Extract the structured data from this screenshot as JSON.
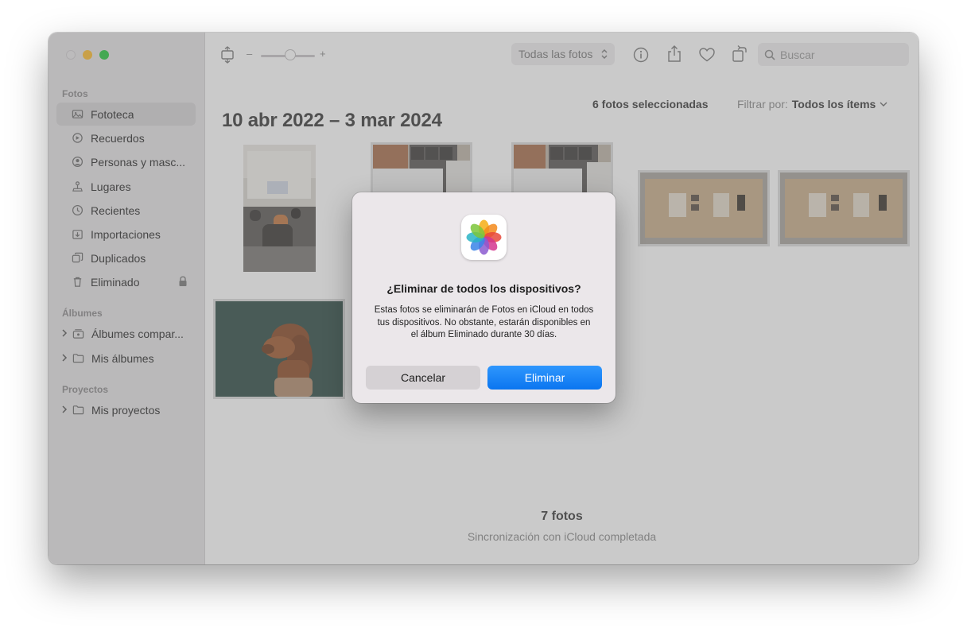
{
  "window": {
    "controls": [
      "close",
      "minimize",
      "zoom"
    ]
  },
  "sidebar": {
    "section_photos": "Fotos",
    "items": [
      {
        "label": "Fototeca",
        "icon": "photo-library-icon",
        "active": true
      },
      {
        "label": "Recuerdos",
        "icon": "memories-icon"
      },
      {
        "label": "Personas y masc...",
        "icon": "people-icon"
      },
      {
        "label": "Lugares",
        "icon": "places-icon"
      },
      {
        "label": "Recientes",
        "icon": "recents-icon"
      },
      {
        "label": "Importaciones",
        "icon": "imports-icon"
      },
      {
        "label": "Duplicados",
        "icon": "duplicates-icon"
      },
      {
        "label": "Eliminado",
        "icon": "trash-icon",
        "locked": true
      }
    ],
    "section_albums": "Álbumes",
    "albums": [
      {
        "label": "Álbumes compar...",
        "icon": "shared-albums-icon"
      },
      {
        "label": "Mis álbumes",
        "icon": "folder-icon"
      }
    ],
    "section_projects": "Proyectos",
    "projects": [
      {
        "label": "Mis proyectos",
        "icon": "folder-icon"
      }
    ]
  },
  "toolbar": {
    "zoom_minus": "–",
    "zoom_plus": "+",
    "zoom_level": 0.55,
    "view_popup": "Todas las fotos",
    "search_placeholder": "Buscar",
    "icons": [
      "info-icon",
      "share-icon",
      "favorite-heart-icon",
      "rotate-icon",
      "search-icon"
    ]
  },
  "library": {
    "date_range": "10 abr 2022 – 3 mar 2024",
    "selected_count": "6 fotos seleccionadas",
    "filter_label": "Filtrar por:",
    "filter_value": "Todos los ítems",
    "photos": [
      {
        "subject": "conference room presentation",
        "selected": false
      },
      {
        "subject": "office shelves and monitor",
        "selected": true
      },
      {
        "subject": "office shelves and monitor",
        "selected": true
      },
      {
        "subject": "cardboard box",
        "selected": true
      },
      {
        "subject": "cardboard box",
        "selected": true
      },
      {
        "subject": "dog with hat",
        "selected": true
      }
    ],
    "photo_total": "7 fotos",
    "sync_status": "Sincronización con iCloud completada"
  },
  "dialog": {
    "title": "¿Eliminar de todos los dispositivos?",
    "message": "Estas fotos se eliminarán de Fotos en iCloud en todos tus dispositivos. No obstante, estarán disponibles en el álbum Eliminado durante 30 días.",
    "cancel_label": "Cancelar",
    "confirm_label": "Eliminar"
  },
  "colors": {
    "accent": "#0a75f0",
    "close_dot": "#e9e7e9",
    "minimize_dot": "#febc2e",
    "zoom_dot": "#28c840"
  }
}
